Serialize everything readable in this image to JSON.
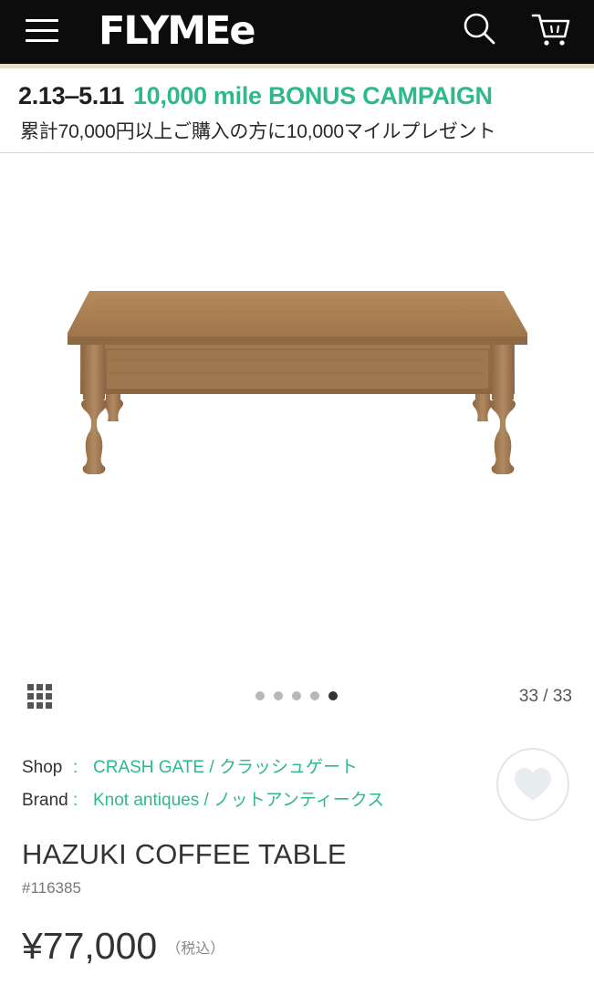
{
  "header": {
    "logo": "FLYMEe",
    "menu_icon": "hamburger-menu-icon",
    "search_icon": "search-icon",
    "cart_icon": "cart-icon",
    "background": "#0c0c0c",
    "accent_line": "#e6ddc8"
  },
  "banner": {
    "dates": "2.13‒5.11",
    "campaign": "10,000 mile BONUS CAMPAIGN",
    "description": "累計70,000円以上ご購入の方に10,000マイルプレゼント",
    "accent": "#2fb98b"
  },
  "gallery": {
    "grid_icon": "grid-icon",
    "dot_count": 5,
    "active_dot": 4,
    "counter": "33 / 33"
  },
  "product": {
    "shop_label": "Shop",
    "shop_colon": ":",
    "shop_value": "CRASH GATE / クラッシュゲート",
    "brand_label": "Brand",
    "brand_colon": ":",
    "brand_value": "Knot antiques / ノットアンティークス",
    "favorite_icon": "heart-icon",
    "title": "HAZUKI COFFEE TABLE",
    "sku": "#116385",
    "price": "¥77,000",
    "tax_note": "（税込）"
  }
}
